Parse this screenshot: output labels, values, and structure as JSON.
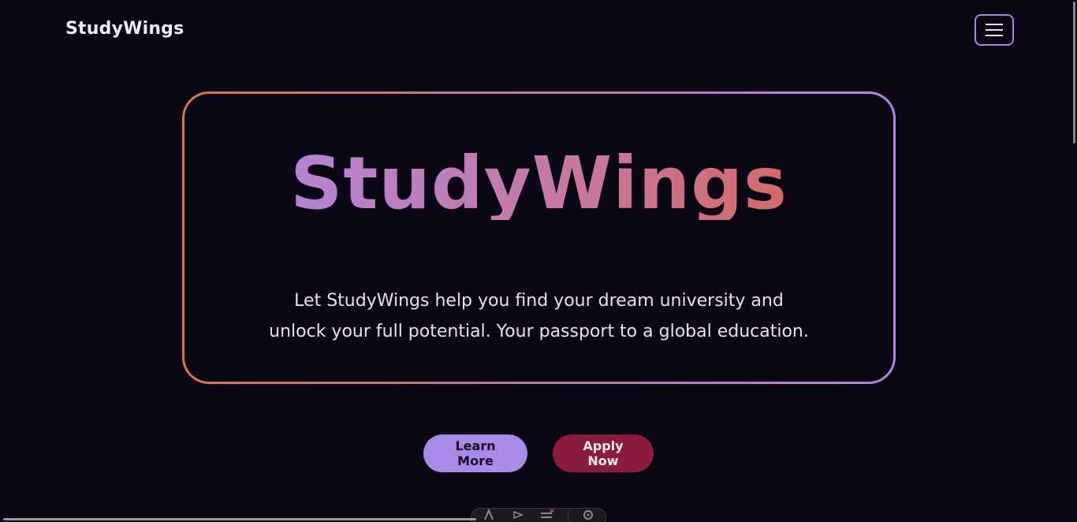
{
  "header": {
    "brand": "StudyWings",
    "menu_icon": "hamburger-menu-icon"
  },
  "hero": {
    "title": "StudyWings",
    "description": "Let StudyWings help you find your dream university and unlock your full potential. Your passport to a global education."
  },
  "actions": {
    "learn_more": "Learn More",
    "apply_now": "Apply Now"
  },
  "colors": {
    "background": "#0b0613",
    "accent_purple": "#a98ae6",
    "accent_orange": "#d8634e",
    "apply_button": "#8a1d3e"
  },
  "devtools_toolbar": {
    "icons": [
      "inspect-icon",
      "pointer-icon",
      "list-icon",
      "gear-icon"
    ]
  }
}
